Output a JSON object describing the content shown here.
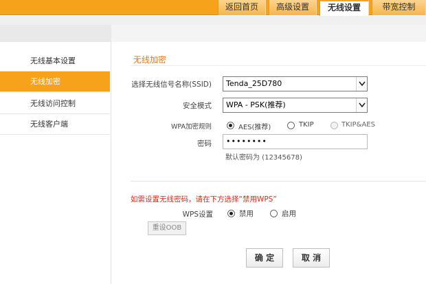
{
  "topnav": {
    "tabs": [
      {
        "label": "返回首页"
      },
      {
        "label": "高级设置"
      },
      {
        "label": "无线设置"
      },
      {
        "label": "带宽控制"
      }
    ]
  },
  "sidebar": {
    "items": [
      {
        "label": "无线基本设置"
      },
      {
        "label": "无线加密"
      },
      {
        "label": "无线访问控制"
      },
      {
        "label": "无线客户端"
      }
    ]
  },
  "form": {
    "section_title": "无线加密",
    "ssid_label": "选择无线信号名称(SSID)",
    "ssid_value": "Tenda_25D780",
    "security_label": "安全模式",
    "security_value": "WPA - PSK(推荐)",
    "rule_label": "WPA加密规则",
    "rule_options": [
      "AES(推荐)",
      "TKIP",
      "TKIP&AES"
    ],
    "password_label": "密码",
    "password_value": "••••••••",
    "default_hint": "默认密码为 (12345678)"
  },
  "wps": {
    "warning": "如需设置无线密码，请在下方选择“禁用WPS”",
    "label": "WPS设置",
    "options": [
      "禁用",
      "启用"
    ],
    "reset_button": "重设OOB"
  },
  "actions": {
    "confirm": "确 定",
    "cancel": "取 消"
  },
  "colors": {
    "accent": "#f7a21b",
    "warning": "#d92b1c",
    "section_title": "#e77817"
  }
}
